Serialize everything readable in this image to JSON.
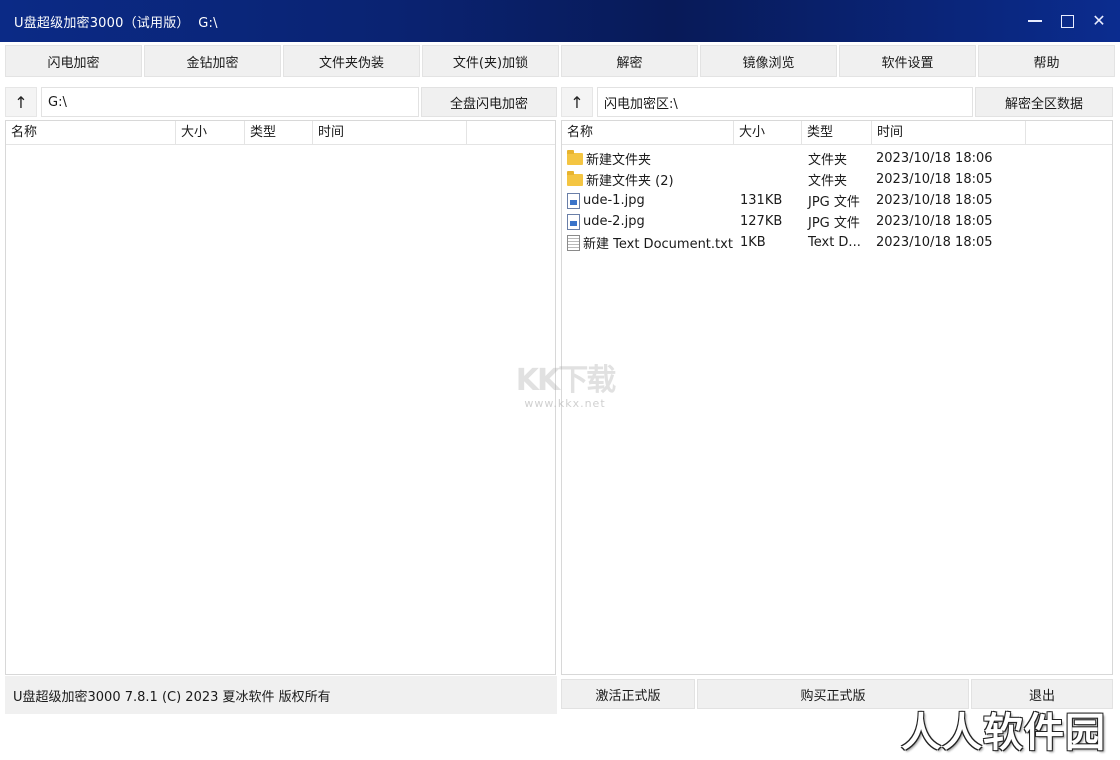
{
  "window": {
    "title": "U盘超级加密3000（试用版）  G:\\",
    "menu_icon": "hamburger-menu-icon",
    "minimize_icon": "minimize-icon",
    "maximize_icon": "maximize-icon",
    "close_icon": "close-icon",
    "close_glyph": "✕"
  },
  "toolbar": {
    "buttons": [
      "闪电加密",
      "金钻加密",
      "文件夹伪装",
      "文件(夹)加锁",
      "解密",
      "镜像浏览",
      "软件设置",
      "帮助"
    ]
  },
  "left": {
    "up_glyph": "↑",
    "path": "G:\\",
    "action": "全盘闪电加密",
    "columns": [
      "名称",
      "大小",
      "类型",
      "时间"
    ],
    "rows": []
  },
  "right": {
    "up_glyph": "↑",
    "path": "闪电加密区:\\",
    "action": "解密全区数据",
    "columns": [
      "名称",
      "大小",
      "类型",
      "时间"
    ],
    "rows": [
      {
        "icon": "folder-icon",
        "name": "新建文件夹",
        "size": "",
        "type": "文件夹",
        "time": "2023/10/18 18:06"
      },
      {
        "icon": "folder-icon",
        "name": "新建文件夹 (2)",
        "size": "",
        "type": "文件夹",
        "time": "2023/10/18 18:05"
      },
      {
        "icon": "image-file-icon",
        "name": "ude-1.jpg",
        "size": "131KB",
        "type": "JPG 文件",
        "time": "2023/10/18 18:05"
      },
      {
        "icon": "image-file-icon",
        "name": "ude-2.jpg",
        "size": "127KB",
        "type": "JPG 文件",
        "time": "2023/10/18 18:05"
      },
      {
        "icon": "text-file-icon",
        "name": "新建 Text Document.txt",
        "size": "1KB",
        "type": "Text D...",
        "time": "2023/10/18 18:05"
      }
    ]
  },
  "watermark": {
    "logo": "KK下载",
    "url": "www.kkx.net"
  },
  "status": {
    "text": "U盘超级加密3000 7.8.1 (C) 2023 夏冰软件 版权所有"
  },
  "bottom_buttons": [
    "激活正式版",
    "购买正式版",
    "退出"
  ],
  "corner_watermark": "人人软件园"
}
